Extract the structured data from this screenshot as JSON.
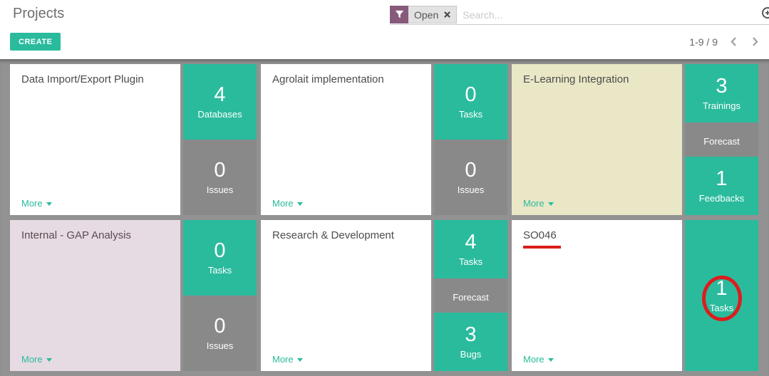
{
  "header": {
    "title": "Projects",
    "create_label": "CREATE"
  },
  "searchbar": {
    "facet_label": "Open",
    "placeholder": "Search..."
  },
  "pager": {
    "range": "1-9 / 9"
  },
  "colors": {
    "accent_teal": "#2abb9d",
    "block_gray": "#898989",
    "page_gray": "#929292",
    "facet_purple": "#875a7b",
    "annotation_red": "#dc1d1d"
  },
  "cards": [
    {
      "title": "Data Import/Export Plugin",
      "bg": "#ffffff",
      "more_label": "More",
      "stats": [
        {
          "value": "4",
          "label": "Databases",
          "color": "teal"
        },
        {
          "value": "0",
          "label": "Issues",
          "color": "gray"
        }
      ]
    },
    {
      "title": "Agrolait implementation",
      "bg": "#ffffff",
      "more_label": "More",
      "stats": [
        {
          "value": "0",
          "label": "Tasks",
          "color": "teal"
        },
        {
          "value": "0",
          "label": "Issues",
          "color": "gray"
        }
      ]
    },
    {
      "title": "E-Learning Integration",
      "bg": "#e9e7c6",
      "more_label": "More",
      "stats": [
        {
          "value": "3",
          "label": "Trainings",
          "color": "teal"
        },
        {
          "value": "",
          "label": "Forecast",
          "color": "gray"
        },
        {
          "value": "1",
          "label": "Feedbacks",
          "color": "teal"
        }
      ]
    },
    {
      "title": "Internal - GAP Analysis",
      "bg": "#e6dbe3",
      "title_color": "#5d4a52",
      "more_label": "More",
      "stats": [
        {
          "value": "0",
          "label": "Tasks",
          "color": "teal"
        },
        {
          "value": "0",
          "label": "Issues",
          "color": "gray"
        }
      ]
    },
    {
      "title": "Research & Development",
      "bg": "#ffffff",
      "more_label": "More",
      "stats": [
        {
          "value": "4",
          "label": "Tasks",
          "color": "teal"
        },
        {
          "value": "",
          "label": "Forecast",
          "color": "gray"
        },
        {
          "value": "3",
          "label": "Bugs",
          "color": "teal"
        }
      ]
    },
    {
      "title": "SO046",
      "bg": "#ffffff",
      "more_label": "More",
      "annotated_underline": true,
      "stats": [
        {
          "value": "1",
          "label": "Tasks",
          "color": "teal",
          "full_height": true,
          "annotated_circle": true
        }
      ]
    }
  ]
}
